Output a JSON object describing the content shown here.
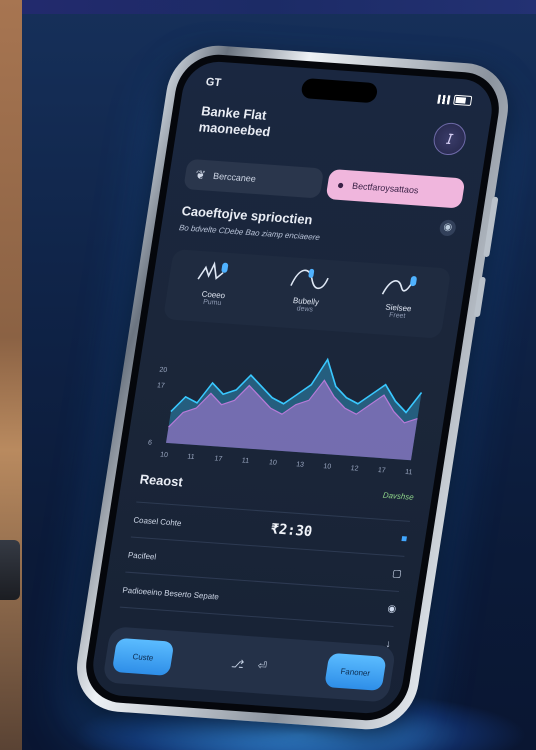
{
  "status": {
    "time": "GT"
  },
  "header": {
    "title": "Banke Flat\nmaoneebed",
    "avatar_glyph": "𝘐"
  },
  "tabs": [
    {
      "label": "Berccanee",
      "icon": "leaf-icon",
      "active": false
    },
    {
      "label": "Bectfaroysattaos",
      "icon": "drop-icon",
      "active": true
    }
  ],
  "section": {
    "title": "Caoeftojve sprioctien",
    "subtitle": "Bo bdvelte CDebe Bao ziamp enciaeere"
  },
  "cards": [
    {
      "label": "Coeeo",
      "sub": "Pumu",
      "icon": "pulse-icon"
    },
    {
      "label": "Bubelly",
      "sub": "dews",
      "icon": "wave-icon"
    },
    {
      "label": "Sielsee",
      "sub": "Freet",
      "icon": "curve-icon"
    }
  ],
  "chart_data": {
    "type": "area",
    "x": [
      "10",
      "11",
      "17",
      "11",
      "10",
      "13",
      "10",
      "12",
      "17",
      "11"
    ],
    "series": [
      {
        "values": [
          12,
          15,
          14,
          18,
          16,
          17,
          20,
          18,
          16,
          15,
          17,
          19,
          24,
          19,
          17,
          16,
          18,
          20,
          17,
          15,
          19
        ]
      },
      {
        "values": [
          9,
          12,
          13,
          16,
          14,
          15,
          18,
          16,
          14,
          13,
          15,
          16,
          20,
          17,
          15,
          14,
          16,
          18,
          15,
          13,
          14
        ]
      }
    ],
    "yticks": [
      "20",
      "17",
      "6"
    ],
    "ylim": [
      6,
      26
    ],
    "colors": [
      "#39c8ff",
      "#b77ad8"
    ]
  },
  "report": {
    "title": "Reaost",
    "link": "Davshse",
    "rows": [
      {
        "label": "Coasel Cohte",
        "value": "₹2:30",
        "icon": "square-icon"
      },
      {
        "label": "Pacifeel",
        "value": "",
        "icon": "box-icon"
      },
      {
        "label": "Padioeeino Beserto Sepate",
        "value": "",
        "icon": "circle-icon"
      },
      {
        "label": "",
        "value": "",
        "icon": "arrow-down-icon"
      }
    ]
  },
  "bottom": {
    "left_button": "Custe",
    "right_button": "Fanoner",
    "mid_icons": [
      "⎇",
      "⏎"
    ]
  }
}
